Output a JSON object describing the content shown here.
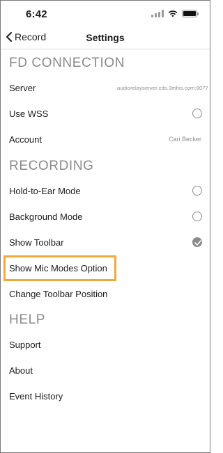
{
  "status_bar": {
    "time": "6:42"
  },
  "nav": {
    "back_label": "Record",
    "title": "Settings"
  },
  "sections": {
    "fd_connection": {
      "header": "FD CONNECTION",
      "server_label": "Server",
      "server_value": "audiorelayserver.cds.3mhis.com:8077",
      "use_wss_label": "Use WSS",
      "account_label": "Account",
      "account_value": "Cari Becker"
    },
    "recording": {
      "header": "RECORDING",
      "hold_to_ear_label": "Hold-to-Ear Mode",
      "background_mode_label": "Background Mode",
      "show_toolbar_label": "Show Toolbar",
      "show_mic_modes_label": "Show Mic Modes Option",
      "change_toolbar_position_label": "Change Toolbar Position"
    },
    "help": {
      "header": "HELP",
      "support_label": "Support",
      "about_label": "About",
      "event_history_label": "Event History"
    }
  },
  "toggles": {
    "use_wss": false,
    "hold_to_ear": false,
    "background_mode": false,
    "show_toolbar": true
  },
  "colors": {
    "highlight": "#f0a93a",
    "section_header": "#8a8a8a",
    "checked_radio": "#8a8a8a"
  }
}
